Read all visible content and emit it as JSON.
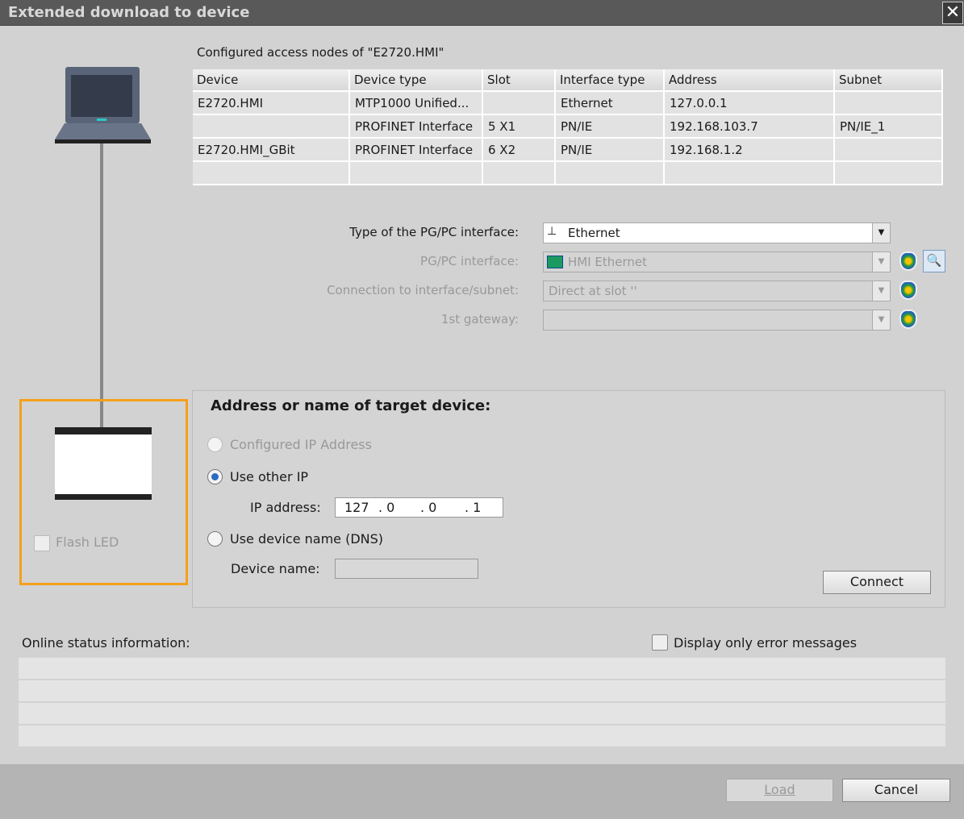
{
  "window": {
    "title": "Extended download to device",
    "close": "✕"
  },
  "nodes": {
    "caption": "Configured access nodes of \"E2720.HMI\"",
    "columns": [
      "Device",
      "Device type",
      "Slot",
      "Interface type",
      "Address",
      "Subnet"
    ],
    "rows": [
      [
        "E2720.HMI",
        "MTP1000 Unified...",
        "",
        "Ethernet",
        "127.0.0.1",
        ""
      ],
      [
        "",
        "PROFINET Interface",
        "5 X1",
        "PN/IE",
        "192.168.103.7",
        "PN/IE_1"
      ],
      [
        "E2720.HMI_GBit",
        "PROFINET Interface",
        "6 X2",
        "PN/IE",
        "192.168.1.2",
        ""
      ],
      [
        "",
        "",
        "",
        "",
        "",
        ""
      ]
    ]
  },
  "iface": {
    "type_label": "Type of the PG/PC interface:",
    "type_value": "Ethernet",
    "pgpc_label": "PG/PC interface:",
    "pgpc_value": "HMI Ethernet",
    "conn_label": "Connection to interface/subnet:",
    "conn_value": "Direct at slot ''",
    "gw_label": "1st gateway:",
    "gw_value": ""
  },
  "target": {
    "title": "Address or name of target device:",
    "opt_configured": "Configured IP Address",
    "opt_other": "Use other IP",
    "ip_label": "IP address:",
    "ip": [
      "127",
      ".  0",
      ".  0",
      ".  1"
    ],
    "opt_dns": "Use device name (DNS)",
    "name_label": "Device name:",
    "name_value": "",
    "connect": "Connect"
  },
  "flash_led": "Flash LED",
  "status": {
    "label": "Online status information:",
    "errors_only": "Display only error messages"
  },
  "footer": {
    "load": "Load",
    "cancel": "Cancel"
  },
  "colors": {
    "highlight": "#f5a01a"
  }
}
